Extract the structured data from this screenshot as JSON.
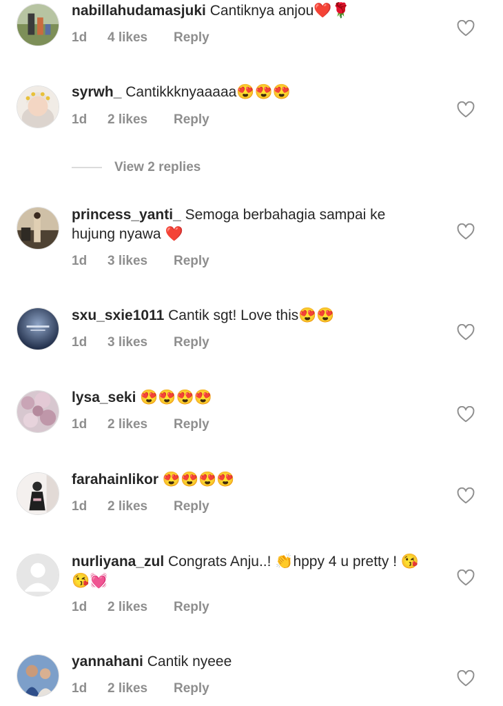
{
  "comments": [
    {
      "username": "nabillahudamasjuki",
      "text": "Cantiknya anjou",
      "emoji": "❤️🌹",
      "time": "1d",
      "likes": "4 likes",
      "reply": "Reply"
    },
    {
      "username": "syrwh_",
      "text": "Cantikkknyaaaaa",
      "emoji": "😍😍😍",
      "time": "1d",
      "likes": "2 likes",
      "reply": "Reply"
    },
    {
      "username": "princess_yanti_",
      "text": "Semoga berbahagia sampai ke hujung nyawa",
      "emoji": " ❤️",
      "time": "1d",
      "likes": "3 likes",
      "reply": "Reply"
    },
    {
      "username": "sxu_sxie1011",
      "text": "Cantik sgt! Love this",
      "emoji": "😍😍",
      "time": "1d",
      "likes": "3 likes",
      "reply": "Reply"
    },
    {
      "username": "lysa_seki",
      "text": "",
      "emoji": "😍😍😍😍",
      "time": "1d",
      "likes": "2 likes",
      "reply": "Reply"
    },
    {
      "username": "farahainlikor",
      "text": "",
      "emoji": "😍😍😍😍",
      "time": "1d",
      "likes": "2 likes",
      "reply": "Reply"
    },
    {
      "username": "nurliyana_zul",
      "text": "Congrats Anju..! 👏hppy 4 u pretty ! ",
      "emoji": "😘😘💓",
      "time": "1d",
      "likes": "2 likes",
      "reply": "Reply"
    },
    {
      "username": "yannahani",
      "text": "Cantik nyeee",
      "emoji": "",
      "time": "1d",
      "likes": "2 likes",
      "reply": "Reply"
    }
  ],
  "view_replies": "View 2 replies"
}
